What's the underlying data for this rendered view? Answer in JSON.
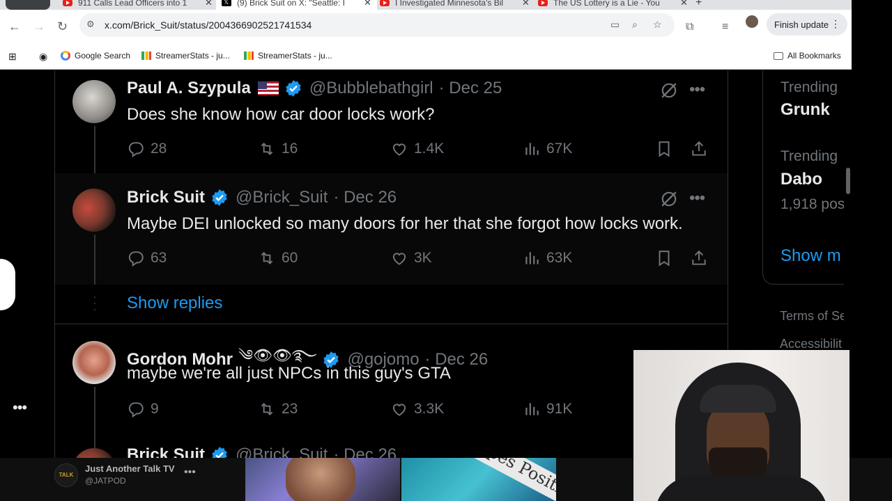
{
  "browser": {
    "tabs": [
      {
        "title": "911 Calls Lead Officers into 1",
        "icon": "youtube-icon"
      },
      {
        "title": "(9) Brick Suit on X: \"Seattle: I",
        "icon": "x-icon"
      },
      {
        "title": "I Investigated Minnesota's Bil",
        "icon": "youtube-icon"
      },
      {
        "title": "The US Lottery is a Lie - You",
        "icon": "youtube-icon"
      }
    ],
    "url": "x.com/Brick_Suit/status/2004366902521741534",
    "finish_update": "Finish update",
    "bookmarks": [
      {
        "label": "Google Search"
      },
      {
        "label": "StreamerStats - ju..."
      },
      {
        "label": "StreamerStats - ju..."
      }
    ],
    "all_bookmarks": "All Bookmarks"
  },
  "tweets": [
    {
      "name": "Paul A. Szypula",
      "handle": "@Bubblebathgirl",
      "date": "· Dec 25",
      "text": "Does she know how car door locks work?",
      "replies": "28",
      "reposts": "16",
      "likes": "1.4K",
      "views": "67K"
    },
    {
      "name": "Brick Suit",
      "handle": "@Brick_Suit",
      "date": "· Dec 26",
      "text": "Maybe DEI unlocked so many doors for her that she forgot how locks work.",
      "replies": "63",
      "reposts": "60",
      "likes": "3K",
      "views": "63K"
    },
    {
      "name": "Gordon Mohr",
      "name_emoji": "༄👁👁࿐",
      "handle": "@gojomo",
      "date": "· Dec 26",
      "text": "maybe we're all just NPCs in this guy's GTA",
      "replies": "9",
      "reposts": "23",
      "likes": "3.3K",
      "views": "91K"
    },
    {
      "name": "Brick Suit",
      "handle": "@Brick_Suit",
      "date": "· Dec 26"
    }
  ],
  "show_replies": "Show replies",
  "sidebar": {
    "trends": [
      {
        "label": "Trending",
        "name": "Grunk"
      },
      {
        "label": "Trending",
        "name": "Dabo",
        "posts": "1,918 pos"
      }
    ],
    "show_more": "Show m",
    "footer": [
      "Terms of Se",
      "Accessibilit"
    ]
  },
  "bottom": {
    "channel_name": "Just Another Talk TV",
    "channel_handle": "@JATPOD",
    "thumb_text": "erpes Positi"
  },
  "colors": {
    "accent": "#1d9bf0",
    "muted": "#71767b",
    "text": "#e7e9ea",
    "background": "#000000"
  }
}
